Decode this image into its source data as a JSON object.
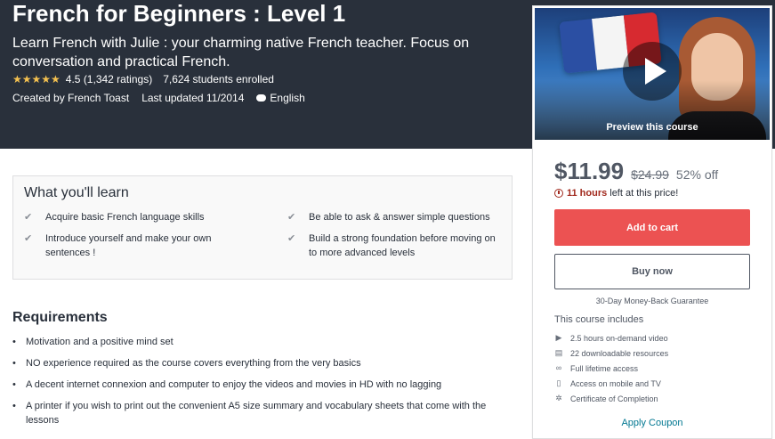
{
  "course": {
    "title": "French for Beginners : Level 1",
    "subtitle": "Learn French with Julie : your charming native French teacher. Focus on conversation and practical French.",
    "stars": "★★★★★",
    "rating_value": "4.5 (1,342 ratings)",
    "enrolled": "7,624 students enrolled",
    "created_by": "Created by French Toast",
    "last_updated": "Last updated 11/2014",
    "language": "English"
  },
  "preview": {
    "label": "Preview this course"
  },
  "pricing": {
    "price": "$11.99",
    "original_price": "$24.99",
    "discount": "52% off",
    "time_left_bold": "11 hours",
    "time_left_rest": "left at this price!",
    "add_to_cart": "Add to cart",
    "buy_now": "Buy now",
    "guarantee": "30-Day Money-Back Guarantee"
  },
  "includes": {
    "title": "This course includes",
    "items": [
      {
        "icon": "video-icon",
        "glyph": "▶",
        "label": "2.5 hours on-demand video"
      },
      {
        "icon": "file-icon",
        "glyph": "▤",
        "label": "22 downloadable resources"
      },
      {
        "icon": "infinity-icon",
        "glyph": "∞",
        "label": "Full lifetime access"
      },
      {
        "icon": "mobile-icon",
        "glyph": "▯",
        "label": "Access on mobile and TV"
      },
      {
        "icon": "certificate-icon",
        "glyph": "✲",
        "label": "Certificate of Completion"
      }
    ],
    "coupon": "Apply Coupon"
  },
  "learn": {
    "title": "What you'll learn",
    "check": "✔",
    "items": [
      "Acquire basic French language skills",
      "Be able to ask & answer simple questions",
      "Introduce yourself and make your own sentences !",
      "Build a strong foundation before moving on to more advanced levels"
    ]
  },
  "requirements": {
    "title": "Requirements",
    "bullet": "•",
    "items": [
      "Motivation and a positive mind set",
      "NO experience required as the course covers everything from the very basics",
      "A decent internet connexion and computer to enjoy the videos and movies in HD with no lagging",
      "A printer if you wish to print out the convenient A5 size summary and vocabulary sheets that come with the lessons"
    ]
  },
  "colors": {
    "hero_bg": "#29303b",
    "star": "#f4c150",
    "cart_button": "#ec5252",
    "timer": "#a1291d",
    "link": "#007791"
  }
}
